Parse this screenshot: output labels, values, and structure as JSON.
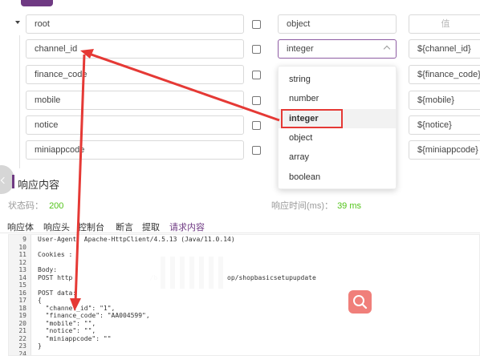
{
  "schema": {
    "rows": [
      {
        "name": "root",
        "type": "object",
        "value": "",
        "value_placeholder": "值"
      },
      {
        "name": "channel_id",
        "type": "integer",
        "value": "${channel_id}"
      },
      {
        "name": "finance_code",
        "type": "",
        "value": "${finance_code}"
      },
      {
        "name": "mobile",
        "type": "",
        "value": "${mobile}"
      },
      {
        "name": "notice",
        "type": "",
        "value": "${notice}"
      },
      {
        "name": "miniappcode",
        "type": "",
        "value": "${miniappcode}"
      }
    ],
    "type_options": [
      "string",
      "number",
      "integer",
      "object",
      "array",
      "boolean"
    ],
    "selected_type": "integer"
  },
  "response": {
    "title": "响应内容",
    "status_label": "状态码：",
    "status_value": "200",
    "time_label": "响应时间(ms)：",
    "time_value": "39 ms",
    "tabs": [
      "响应体",
      "响应头",
      "控制台",
      "断言",
      "提取",
      "请求内容"
    ],
    "active_tab": "请求内容"
  },
  "code_lines": [
    {
      "n": "9",
      "text": "User-Agent: Apache-HttpClient/4.5.13 (Java/11.0.14)"
    },
    {
      "n": "10",
      "text": ""
    },
    {
      "n": "11",
      "text": "Cookies :"
    },
    {
      "n": "12",
      "text": ""
    },
    {
      "n": "13",
      "text": "Body:"
    },
    {
      "n": "14",
      "text": "POST http                    /b                  op/shopbasicsetupupdate"
    },
    {
      "n": "15",
      "text": ""
    },
    {
      "n": "16",
      "text": "POST data:"
    },
    {
      "n": "17",
      "text": "{"
    },
    {
      "n": "18",
      "text": "  \"channel_id\": \"1\","
    },
    {
      "n": "19",
      "text": "  \"finance_code\": \"AA004599\","
    },
    {
      "n": "20",
      "text": "  \"mobile\": \"\","
    },
    {
      "n": "21",
      "text": "  \"notice\": \"\","
    },
    {
      "n": "22",
      "text": "  \"miniappcode\": \"\""
    },
    {
      "n": "23",
      "text": "}"
    },
    {
      "n": "24",
      "text": ""
    }
  ],
  "colors": {
    "accent": "#6f3a83",
    "annotation_red": "#e53935",
    "status_green": "#52c41a",
    "fab": "#f07f7a"
  },
  "icons": [
    "caret-down-icon",
    "chevron-up-icon",
    "chevron-left-icon",
    "search-icon"
  ]
}
